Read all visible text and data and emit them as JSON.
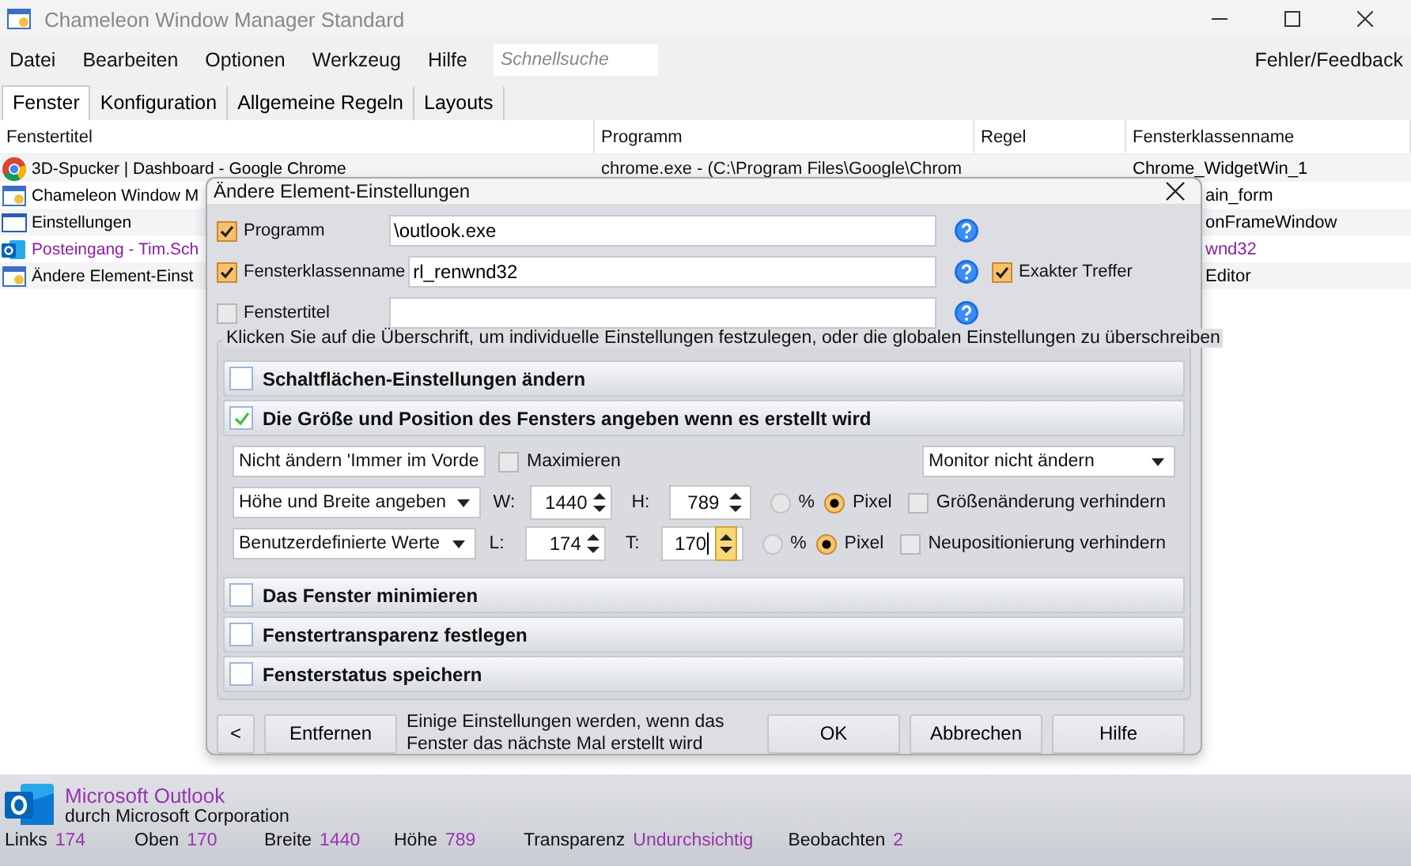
{
  "window": {
    "title": "Chameleon Window Manager Standard"
  },
  "menu": [
    "Datei",
    "Bearbeiten",
    "Optionen",
    "Werkzeug",
    "Hilfe"
  ],
  "search": {
    "placeholder": "Schnellsuche"
  },
  "feedback": "Fehler/Feedback",
  "tabs": [
    {
      "label": "Fenster",
      "selected": true
    },
    {
      "label": "Konfiguration",
      "selected": false
    },
    {
      "label": "Allgemeine Regeln",
      "selected": false
    },
    {
      "label": "Layouts",
      "selected": false
    }
  ],
  "table": {
    "columns": [
      "Fenstertitel",
      "Programm",
      "Regel",
      "Fensterklassenname"
    ],
    "rows": [
      {
        "kind": "chrome",
        "color": "#000000",
        "title": "3D-Spucker | Dashboard - Google Chrome",
        "program": "chrome.exe - (C:\\Program Files\\Google\\Chrom",
        "class": "Chrome_WidgetWin_1"
      },
      {
        "kind": "chameleon",
        "color": "#000000",
        "title": "Chameleon Window M",
        "class": "ain_form"
      },
      {
        "kind": "window",
        "color": "#000000",
        "title": "Einstellungen",
        "class": "onFrameWindow"
      },
      {
        "kind": "outlook",
        "color": "#8a1fa0",
        "title": "Posteingang - Tim.Sch",
        "class": "wnd32"
      },
      {
        "kind": "chameleon",
        "color": "#000000",
        "title": "Ändere Element-Einst",
        "class": "Editor"
      }
    ]
  },
  "dialog": {
    "title": "Ändere Element-Einstellungen",
    "fields": [
      {
        "label": "Programm",
        "checked": true,
        "value": "\\outlook.exe"
      },
      {
        "label": "Fensterklassenname",
        "checked": true,
        "value": "rl_renwnd32"
      },
      {
        "label": "Fenstertitel",
        "checked": false
      }
    ],
    "exact_match": {
      "label": "Exakter Treffer",
      "checked": true
    },
    "group_caption": "Klicken Sie auf die Überschrift, um individuelle Einstellungen festzulegen, oder die globalen Einstellungen zu überschreiben",
    "sections": [
      {
        "title": "Schaltflächen-Einstellungen ändern",
        "checked": false,
        "expanded": false
      },
      {
        "title": "Die Größe und Position des Fensters angeben wenn es erstellt wird",
        "checked": true,
        "expanded": true
      },
      {
        "title": "Das Fenster minimieren",
        "checked": false,
        "expanded": false
      },
      {
        "title": "Fenstertransparenz festlegen",
        "checked": false,
        "expanded": false
      },
      {
        "title": "Fensterstatus speichern",
        "checked": false,
        "expanded": false
      }
    ],
    "topmost_dropdown": "Nicht ändern 'Immer im Vorde",
    "maximize": {
      "label": "Maximieren",
      "checked": false
    },
    "monitor_dropdown": "Monitor nicht ändern",
    "size_row": {
      "dropdown": "Höhe und Breite angeben",
      "a_label": "W:",
      "a_value": "1440",
      "b_label": "H:",
      "b_value": "789",
      "b_focused": false,
      "percent": {
        "label": "%",
        "selected": false
      },
      "pixel": {
        "label": "Pixel",
        "selected": true
      },
      "lock": {
        "label": "Größenänderung verhindern",
        "checked": false
      }
    },
    "pos_row": {
      "dropdown": "Benutzerdefinierte Werte",
      "a_label": "L:",
      "a_value": "174",
      "b_label": "T:",
      "b_value": "170",
      "b_focused": true,
      "percent": {
        "label": "%",
        "selected": false
      },
      "pixel": {
        "label": "Pixel",
        "selected": true
      },
      "lock": {
        "label": "Neupositionierung verhindern",
        "checked": false
      }
    },
    "back_button": "<",
    "remove_button": "Entfernen",
    "note": "Einige Einstellungen werden, wenn das Fenster das nächste Mal erstellt wird",
    "buttons": [
      "OK",
      "Abbrechen",
      "Hilfe"
    ]
  },
  "status": {
    "app": "Microsoft Outlook",
    "publisher": "durch Microsoft Corporation",
    "stats": [
      {
        "label": "Links",
        "value": "174"
      },
      {
        "label": "Oben",
        "value": "170"
      },
      {
        "label": "Breite",
        "value": "1440"
      },
      {
        "label": "Höhe",
        "value": "789"
      },
      {
        "label": "Transparenz",
        "value": "Undurchsichtig"
      },
      {
        "label": "Beobachten",
        "value": "2"
      }
    ]
  }
}
